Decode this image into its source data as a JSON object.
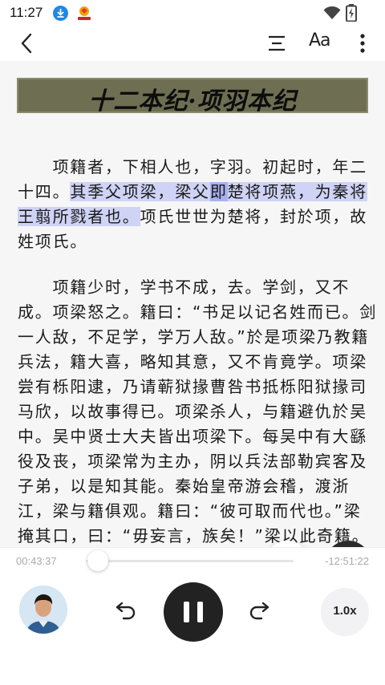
{
  "status_bar": {
    "time": "11:27"
  },
  "chapter_title": "十二本纪·项羽本纪",
  "paragraphs": {
    "p1": {
      "l1": "项籍者，下相人也，字羽。初起时，年二",
      "l2a": "十四。",
      "l2b": "其季父项梁，梁父",
      "l2c": "即",
      "l2d": "楚将项燕，为秦将",
      "l3a": "王翦所戮者也。",
      "l3b": "项氏世世为楚将，封於项，故",
      "l4": "姓项氏。"
    },
    "p2": [
      "项籍少时，学书不成，去。学剑，又不",
      "成。项梁怒之。籍曰：“书足以记名姓而已。剑",
      "一人敌，不足学，学万人敌。”於是项梁乃教籍",
      "兵法，籍大喜，略知其意，又不肯竟学。项梁",
      "尝有栎阳逮，乃请蕲狱掾曹咎书抵栎阳狱掾司",
      "马欣，以故事得已。项梁杀人，与籍避仇於吴",
      "中。吴中贤士大夫皆出项梁下。每吴中有大繇",
      "役及丧，项梁常为主办，阴以兵法部勒宾客及",
      "子弟，以是知其能。秦始皇帝游会稽，渡浙",
      "江，梁与籍俱观。籍曰：“彼可取而代也。”梁",
      "掩其口，曰：“毋妄言，族矣！”梁以此奇籍。"
    ]
  },
  "floating": {
    "ai_label": "Ai"
  },
  "player": {
    "current_time": "00:43:37",
    "remaining_time": "-12:51:22",
    "progress": 0.055,
    "speed_label": "1.0x"
  }
}
